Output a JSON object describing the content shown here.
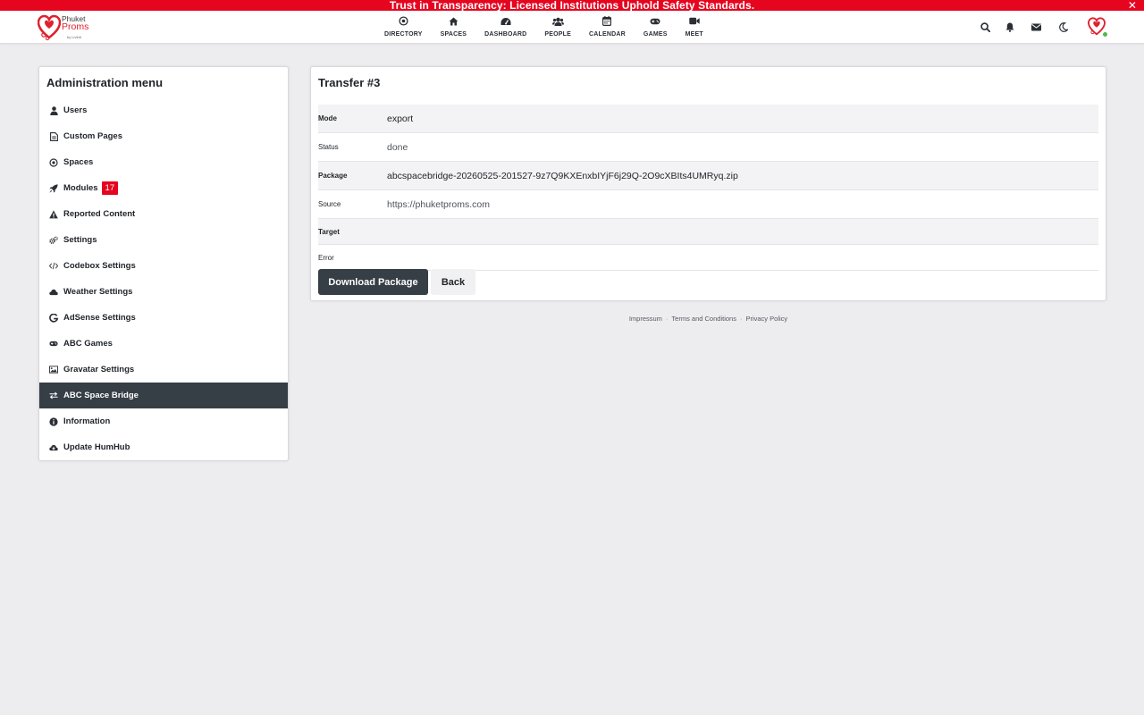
{
  "banner": {
    "text": "Trust in Transparency: Licensed Institutions Uphold Safety Standards.",
    "close": "✕"
  },
  "brand": {
    "line1": "Phuket",
    "line2": "Proms",
    "line3": "by Livfnit",
    "color": "#e0212e"
  },
  "nav": [
    {
      "label": "DIRECTORY",
      "icon": "directory-icon"
    },
    {
      "label": "SPACES",
      "icon": "home-icon"
    },
    {
      "label": "DASHBOARD",
      "icon": "dashboard-icon"
    },
    {
      "label": "PEOPLE",
      "icon": "people-icon"
    },
    {
      "label": "CALENDAR",
      "icon": "calendar-icon"
    },
    {
      "label": "GAMES",
      "icon": "gamepad-icon"
    },
    {
      "label": "MEET",
      "icon": "video-icon"
    }
  ],
  "toolbar": {
    "icons": [
      "search-icon",
      "bell-icon",
      "envelope-icon",
      "moon-icon"
    ]
  },
  "admin": {
    "title": "Administration menu",
    "items": [
      {
        "label": "Users",
        "icon": "user-icon"
      },
      {
        "label": "Custom Pages",
        "icon": "page-icon"
      },
      {
        "label": "Spaces",
        "icon": "spaces-icon"
      },
      {
        "label": "Modules",
        "icon": "rocket-icon",
        "badge": "17"
      },
      {
        "label": "Reported Content",
        "icon": "warning-icon"
      },
      {
        "label": "Settings",
        "icon": "cogs-icon"
      },
      {
        "label": "Codebox Settings",
        "icon": "code-icon"
      },
      {
        "label": "Weather Settings",
        "icon": "cloud-icon"
      },
      {
        "label": "AdSense Settings",
        "icon": "google-icon"
      },
      {
        "label": "ABC Games",
        "icon": "gamepad-icon"
      },
      {
        "label": "Gravatar Settings",
        "icon": "image-icon"
      },
      {
        "label": "ABC Space Bridge",
        "icon": "exchange-icon",
        "active": true
      },
      {
        "label": "Information",
        "icon": "info-icon"
      },
      {
        "label": "Update HumHub",
        "icon": "cloud-download-icon"
      }
    ]
  },
  "transfer": {
    "title": "Transfer #3",
    "rows": [
      {
        "label": "Mode",
        "value": "export"
      },
      {
        "label": "Status",
        "value": "done"
      },
      {
        "label": "Package",
        "value": "abcspacebridge-20260525-201527-9z7Q9KXEnxbIYjF6j29Q-2O9cXBIts4UMRyq.zip"
      },
      {
        "label": "Source",
        "value": "https://phuketproms.com"
      },
      {
        "label": "Target",
        "value": ""
      },
      {
        "label": "Error",
        "value": ""
      }
    ],
    "download_label": "Download Package",
    "back_label": "Back"
  },
  "footer": {
    "links": [
      "Impressum",
      "Terms and Conditions",
      "Privacy Policy"
    ],
    "separator": "·"
  },
  "colors": {
    "accent": "#e5051f",
    "dark": "#363e46",
    "background": "#ededf0"
  }
}
